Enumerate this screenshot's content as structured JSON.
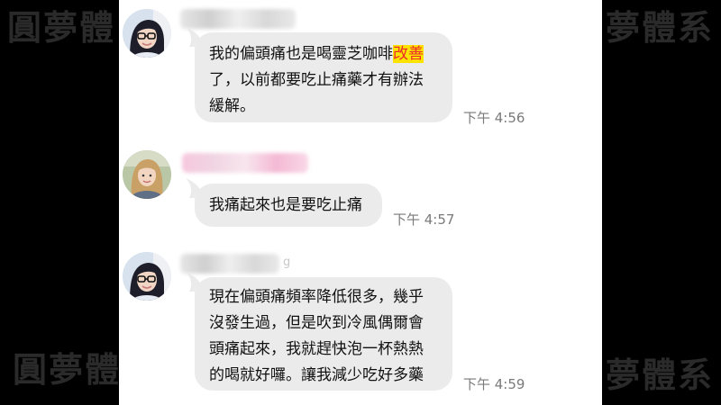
{
  "watermark": {
    "text_top_left": "圓夢體",
    "text_top_right": "夢體系",
    "text_bottom_left": "圓夢體",
    "text_bottom_right": "夢體系"
  },
  "messages": [
    {
      "sender_name_tail": "",
      "line1_pre": "我的偏頭痛也是喝靈芝咖啡",
      "line1_highlight": "改善",
      "line2": "了，以前都要吃止痛藥才有辦法",
      "line3": "緩解。",
      "time": "下午 4:56",
      "avatar": "avatar-woman-glasses-icon"
    },
    {
      "sender_name_tail": "",
      "text": "我痛起來也是要吃止痛",
      "time": "下午 4:57",
      "avatar": "avatar-woman-blonde-icon"
    },
    {
      "sender_name_tail": "g",
      "line1": "現在偏頭痛頻率降低很多，幾乎",
      "line2": "沒發生過，但是吹到冷風偶爾會",
      "line3": "頭痛起來，我就趕快泡一杯熱熱",
      "line4": "的喝就好囉。讓我減少吃好多藥",
      "time": "下午 4:59",
      "avatar": "avatar-woman-glasses-icon"
    }
  ],
  "colors": {
    "bubble": "#ebebeb",
    "highlight_bg": "#ffe300",
    "highlight_text": "#ea2b2b",
    "time": "#7a7a7a"
  }
}
